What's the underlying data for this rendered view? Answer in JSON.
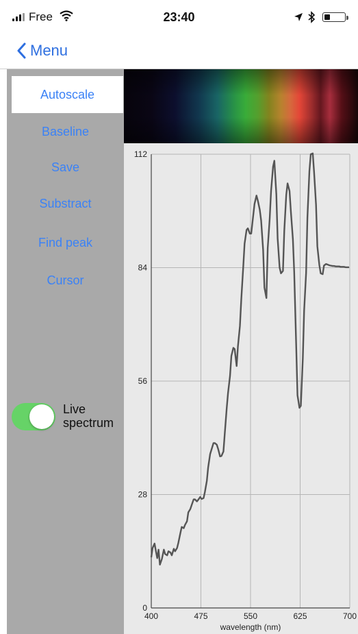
{
  "status_bar": {
    "carrier": "Free",
    "time": "23:40",
    "icons": [
      "signal-icon",
      "wifi-icon",
      "location-arrow-icon",
      "bluetooth-icon",
      "battery-icon"
    ]
  },
  "nav": {
    "back_label": "Menu",
    "back_icon": "chevron-left-icon"
  },
  "sidebar": {
    "items": [
      {
        "label": "Autoscale",
        "active": true
      },
      {
        "label": "Baseline"
      },
      {
        "label": "Save"
      },
      {
        "label": "Substract"
      },
      {
        "label": "Find peak"
      },
      {
        "label": "Cursor"
      }
    ],
    "toggle": {
      "label_line1": "Live",
      "label_line2": "spectrum",
      "on": true
    }
  },
  "colors": {
    "accent": "#3b82f6",
    "toggle_on": "#66d367",
    "sidebar_bg": "#a9a9a9",
    "plot_line": "#555555"
  },
  "chart_data": {
    "type": "line",
    "xlabel": "wavelength (nm)",
    "ylabel": "",
    "title": "",
    "xlim": [
      400,
      700
    ],
    "ylim": [
      0,
      112
    ],
    "xticks": [
      400,
      475,
      550,
      625,
      700
    ],
    "yticks": [
      0,
      28,
      56,
      84,
      112
    ],
    "xtick_labels": [
      "400",
      "475",
      "550",
      "625",
      "700"
    ],
    "ytick_labels": [
      "0",
      "28",
      "56",
      "84",
      "112"
    ],
    "grid": true,
    "x": [
      400,
      402,
      405,
      407,
      409,
      411,
      413,
      416,
      419,
      421,
      424,
      426,
      429,
      431,
      434,
      436,
      439,
      441,
      444,
      446,
      449,
      451,
      454,
      456,
      459,
      461,
      464,
      466,
      469,
      471,
      474,
      476,
      479,
      481,
      484,
      486,
      489,
      491,
      494,
      496,
      499,
      501,
      504,
      506,
      509,
      511,
      514,
      516,
      519,
      521,
      524,
      526,
      529,
      531,
      534,
      536,
      539,
      541,
      544,
      546,
      549,
      551,
      554,
      556,
      559,
      561,
      564,
      566,
      569,
      571,
      574,
      576,
      579,
      581,
      584,
      586,
      589,
      591,
      594,
      596,
      599,
      601,
      604,
      606,
      609,
      611,
      614,
      616,
      619,
      621,
      624,
      626,
      629,
      631,
      634,
      636,
      639,
      641,
      644,
      646,
      649,
      651,
      654,
      656,
      659,
      661,
      664,
      666,
      669,
      671,
      674,
      676,
      679,
      681,
      684,
      686,
      689,
      691,
      694,
      696,
      699
    ],
    "y": [
      12.5,
      14.8,
      15.9,
      14.0,
      12.3,
      14.4,
      10.7,
      12.1,
      14.4,
      13.3,
      13.0,
      14.0,
      13.7,
      13.0,
      14.6,
      14.0,
      14.8,
      16.1,
      18.5,
      20.0,
      19.7,
      20.5,
      21.4,
      23.6,
      24.4,
      25.4,
      26.8,
      26.8,
      26.3,
      26.7,
      27.4,
      26.9,
      27.1,
      28.6,
      31.4,
      34.7,
      38.0,
      39.1,
      40.7,
      40.7,
      40.3,
      39.3,
      37.4,
      37.5,
      38.6,
      42.9,
      49.3,
      53.0,
      57.2,
      62.2,
      64.2,
      63.9,
      59.7,
      64.6,
      69.6,
      76.2,
      84.3,
      89.9,
      93.3,
      93.7,
      92.4,
      92.4,
      96.8,
      99.7,
      101.8,
      100.6,
      98.3,
      95.6,
      88.4,
      79.1,
      76.5,
      88.8,
      96.1,
      102.9,
      108.9,
      110.4,
      102.1,
      91.2,
      84.0,
      82.6,
      83.2,
      93.1,
      102.0,
      104.8,
      102.9,
      97.7,
      91.0,
      82.9,
      64.8,
      52.5,
      49.4,
      49.9,
      61.6,
      73.4,
      82.7,
      96.3,
      107.8,
      112.0,
      112.2,
      107.7,
      99.5,
      89.3,
      84.7,
      82.6,
      82.4,
      84.5,
      84.9,
      84.8,
      84.6,
      84.5,
      84.4,
      84.4,
      84.3,
      84.3,
      84.3,
      84.2,
      84.2,
      84.2,
      84.1,
      84.1,
      84.1
    ]
  }
}
